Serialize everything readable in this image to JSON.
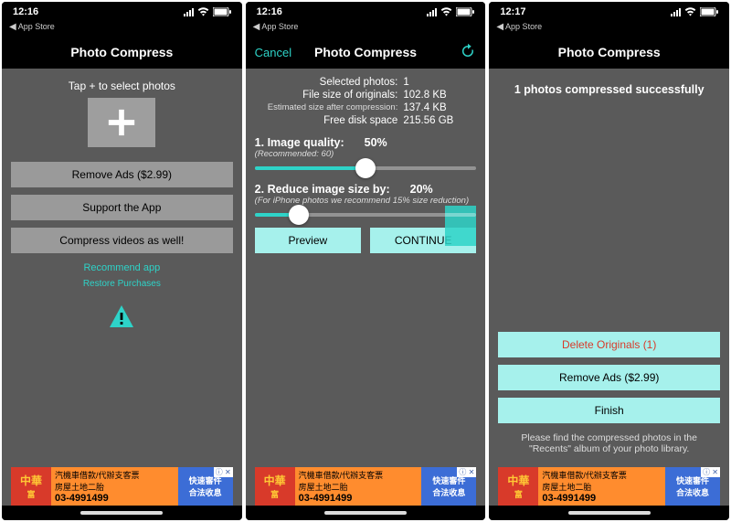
{
  "status": {
    "back_label": "App Store",
    "signal_icon": "signal-bars",
    "wifi_icon": "wifi",
    "battery_icon": "battery"
  },
  "screens": [
    {
      "time": "12:16",
      "nav": {
        "title": "Photo Compress"
      },
      "select_hint": "Tap + to select photos",
      "buttons": {
        "remove_ads": "Remove Ads ($2.99)",
        "support": "Support the App",
        "compress_video": "Compress videos as well!"
      },
      "links": {
        "recommend": "Recommend app",
        "restore": "Restore Purchases"
      },
      "warning_icon": "warning-triangle"
    },
    {
      "time": "12:16",
      "nav": {
        "left": "Cancel",
        "title": "Photo Compress",
        "right_icon": "refresh"
      },
      "info": {
        "selected_label": "Selected photos:",
        "selected_value": "1",
        "orig_label": "File size of originals:",
        "orig_value": "102.8 KB",
        "est_label": "Estimated size after compression:",
        "est_value": "137.4 KB",
        "free_label": "Free disk space",
        "free_value": "215.56 GB"
      },
      "quality": {
        "label": "1. Image quality:",
        "value_text": "50%",
        "value_pct": 50,
        "sub": "(Recommended: 60)"
      },
      "reduce": {
        "label": "2. Reduce image size by:",
        "value_text": "20%",
        "value_pct": 20,
        "sub": "(For iPhone photos we recommend 15% size reduction)"
      },
      "preview_btn": "Preview",
      "continue_btn": "CONTINUE"
    },
    {
      "time": "12:17",
      "nav": {
        "title": "Photo Compress"
      },
      "success": "1 photos compressed successfully",
      "buttons": {
        "delete": "Delete Originals (1)",
        "remove_ads": "Remove Ads ($2.99)",
        "finish": "Finish"
      },
      "note": "Please find the compressed photos in the \"Recents\" album of your photo library."
    }
  ],
  "ad": {
    "brand1": "中華",
    "brand2": "富",
    "line1": "汽機車借款/代辦支客票",
    "line2": "房屋土地二胎",
    "phone": "03-4991499",
    "slogan1": "快速審件",
    "slogan2": "合法收息",
    "tag": "ⓘ ✕"
  }
}
